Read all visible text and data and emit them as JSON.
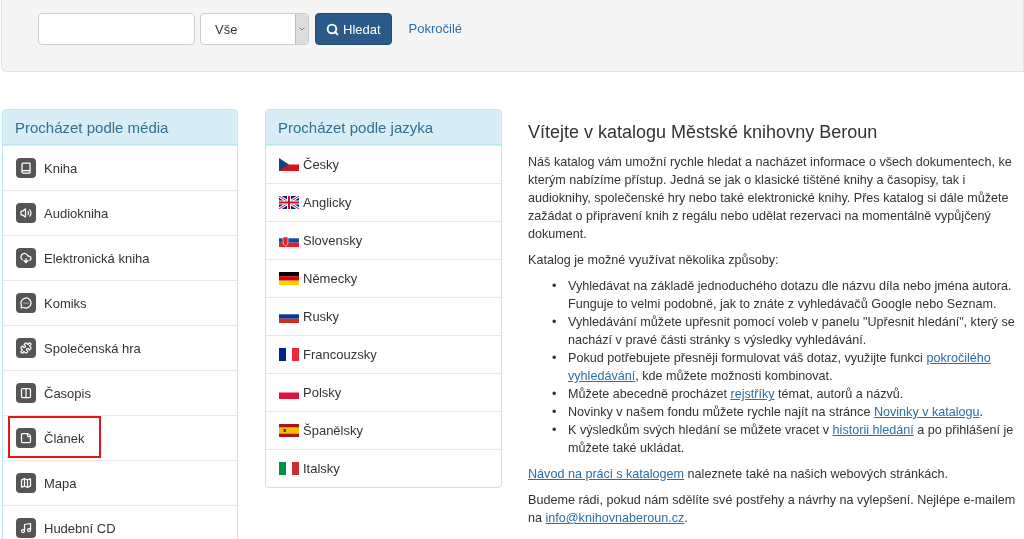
{
  "search_bar": {
    "scope_select": {
      "value": "Vše"
    },
    "search_button": {
      "label": "Hledat"
    },
    "advanced_link": {
      "label": "Pokročilé"
    }
  },
  "media_panel": {
    "title": "Procházet podle média",
    "items": [
      {
        "kind": "book",
        "label": "Kniha",
        "highlighted": false
      },
      {
        "kind": "audio",
        "label": "Audiokniha",
        "highlighted": false
      },
      {
        "kind": "ebook",
        "label": "Elektronická kniha",
        "highlighted": false
      },
      {
        "kind": "comic",
        "label": "Komiks",
        "highlighted": false
      },
      {
        "kind": "game",
        "label": "Společenská hra",
        "highlighted": false
      },
      {
        "kind": "magazine",
        "label": "Časopis",
        "highlighted": false
      },
      {
        "kind": "article",
        "label": "Článek",
        "highlighted": true
      },
      {
        "kind": "map",
        "label": "Mapa",
        "highlighted": false
      },
      {
        "kind": "music",
        "label": "Hudební CD",
        "highlighted": false
      }
    ]
  },
  "language_panel": {
    "title": "Procházet podle jazyka",
    "items": [
      {
        "kind": "czech",
        "label": "Česky"
      },
      {
        "kind": "english",
        "label": "Anglicky"
      },
      {
        "kind": "slovak",
        "label": "Slovensky"
      },
      {
        "kind": "german",
        "label": "Německy"
      },
      {
        "kind": "russian",
        "label": "Rusky"
      },
      {
        "kind": "french",
        "label": "Francouzsky"
      },
      {
        "kind": "polish",
        "label": "Polsky"
      },
      {
        "kind": "spanish",
        "label": "Španělsky"
      },
      {
        "kind": "italian",
        "label": "Italsky"
      }
    ]
  },
  "welcome": {
    "heading": "Vítejte v katalogu Městské knihovny Beroun",
    "intro": "Náš katalog vám umožní rychle hledat a nacházet informace o všech dokumentech, ke kterým nabízíme přístup. Jedná se jak o klasické tištěné knihy a časopisy, tak i audioknihy, společenské hry nebo také elektronické knihy. Přes katalog si dále můžete zažádat o připravení knih z regálu nebo udělat rezervaci na momentálně vypůjčený dokument.",
    "ways_intro": "Katalog je možné využívat několika způsoby:",
    "ways": [
      {
        "bullet": "•",
        "segments": [
          {
            "text": "Vyhledávat na základě jednoduchého dotazu dle názvu díla nebo jména autora. Funguje to velmi podobně, jak to znáte z vyhledávačů Google nebo Seznam.",
            "link": false
          }
        ]
      },
      {
        "bullet": "•",
        "segments": [
          {
            "text": "Vyhledávání můžete upřesnit pomocí voleb v panelu \"Upřesnit hledání\", který se nachází v pravé části stránky s výsledky vyhledávání.",
            "link": false
          }
        ]
      },
      {
        "bullet": "•",
        "segments": [
          {
            "text": "Pokud potřebujete přesněji formulovat váš dotaz, využijte funkci ",
            "link": false
          },
          {
            "text": "pokročilého",
            "link": true
          },
          {
            "text": "vyhledávání",
            "link": true
          },
          {
            "text": ", kde můžete možnosti kombinovat.",
            "link": false
          }
        ]
      },
      {
        "bullet": "•",
        "segments": [
          {
            "text": "Můžete abecedně procházet ",
            "link": false
          },
          {
            "text": "rejstříky",
            "link": true
          },
          {
            "text": " témat, autorů a názvů.",
            "link": false
          }
        ]
      },
      {
        "bullet": "•",
        "segments": [
          {
            "text": "Novinky v našem fondu můžete rychle najít na stránce ",
            "link": false
          },
          {
            "text": "Novinky v katalogu",
            "link": true
          },
          {
            "text": ".",
            "link": false
          }
        ]
      },
      {
        "bullet": "•",
        "segments": [
          {
            "text": "K výsledkům svých hledání se můžete vracet v ",
            "link": false
          },
          {
            "text": "historii hledání",
            "link": true
          },
          {
            "text": " a po přihlášení je můžete také ukládat.",
            "link": false
          }
        ]
      }
    ],
    "guide": [
      {
        "text": "Návod na práci s katalogem",
        "link": true
      },
      {
        "text": " naleznete také na našich webových stránkách.",
        "link": false
      }
    ],
    "feedback": [
      {
        "text": "Budeme rádi, pokud nám sdělíte své postřehy a návrhy na vylepšení. Nejlépe e-mailem na ",
        "link": false
      },
      {
        "text": "info@knihovnaberoun.cz",
        "link": true
      },
      {
        "text": ".",
        "link": false
      }
    ]
  }
}
